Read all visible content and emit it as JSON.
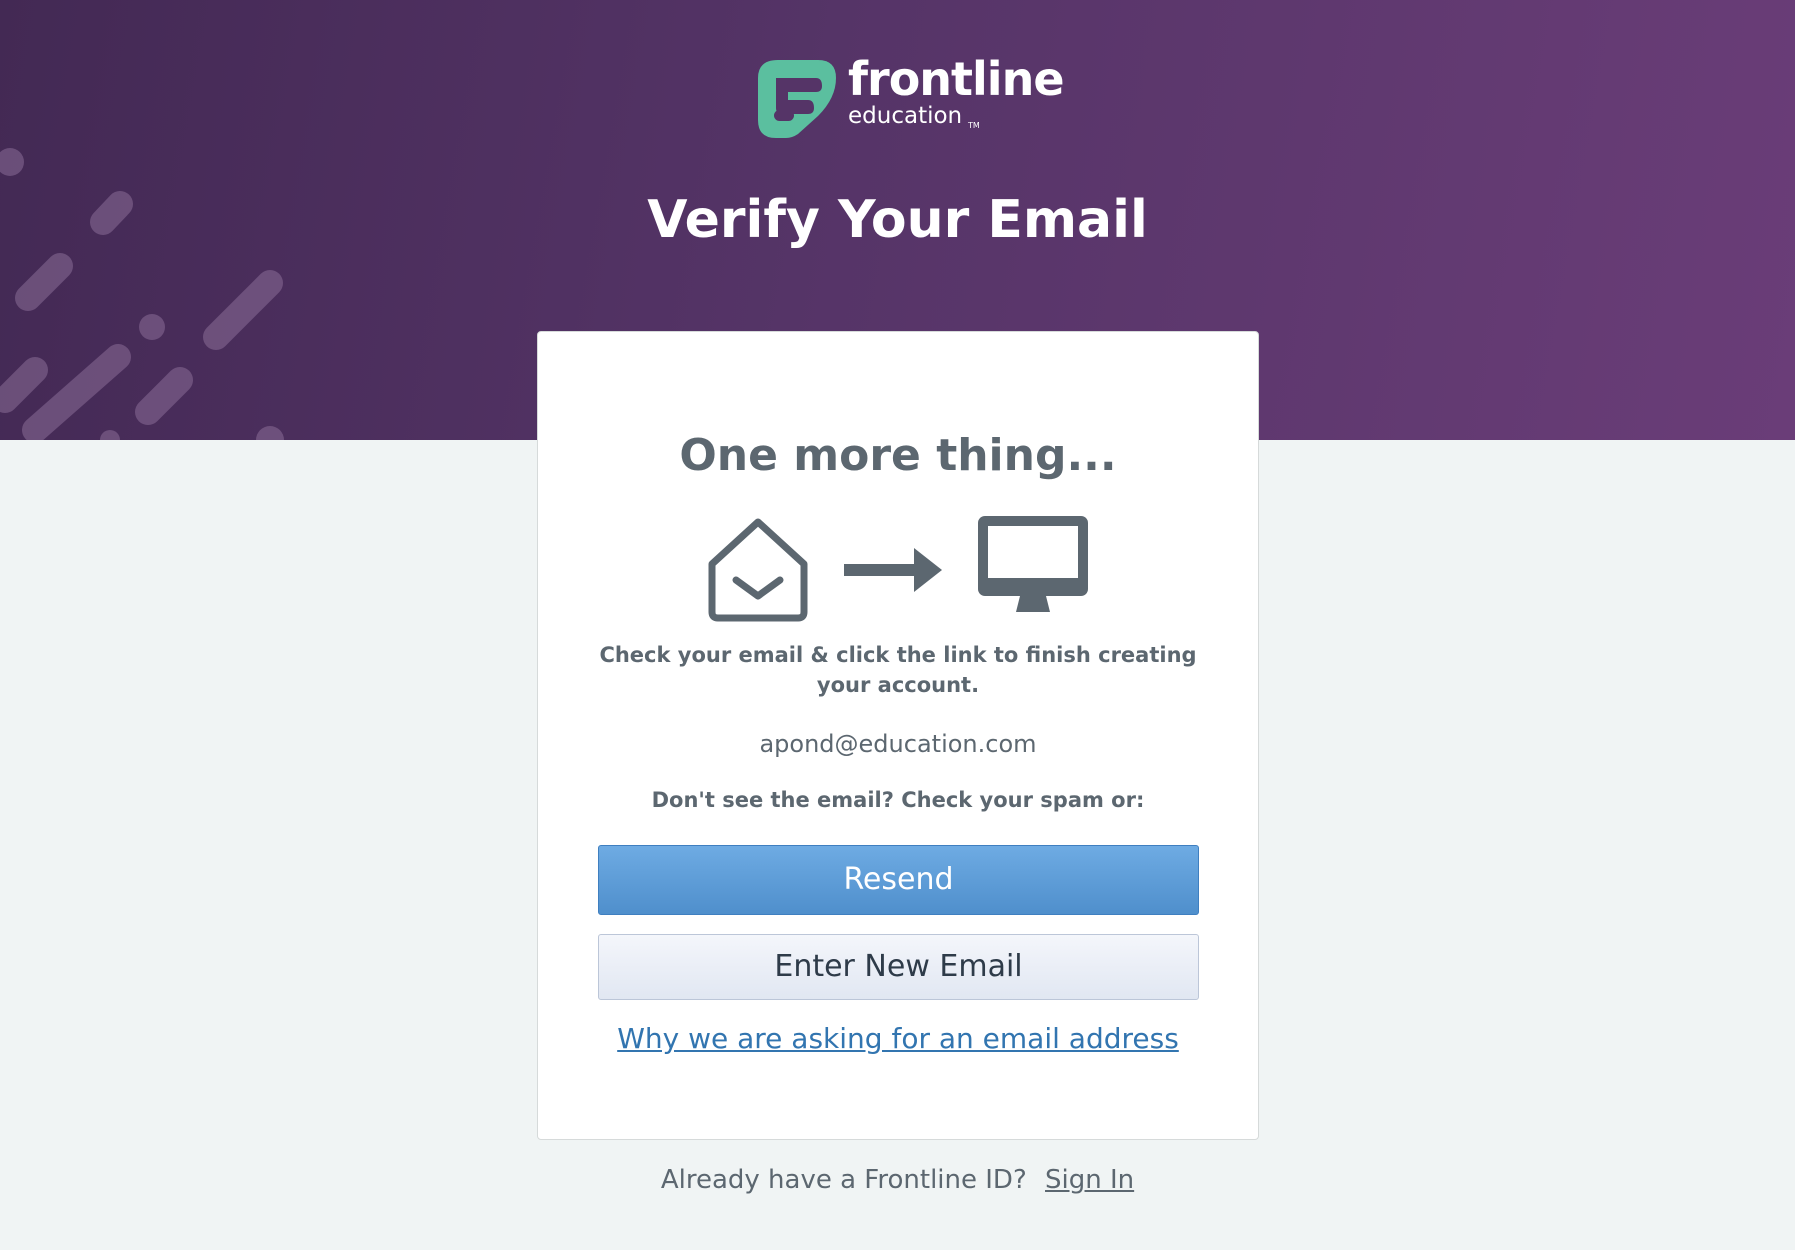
{
  "header": {
    "brand_name": "frontline",
    "brand_sub": "education",
    "brand_tm": "TM",
    "title": "Verify Your Email"
  },
  "card": {
    "heading": "One more thing...",
    "icons": [
      "open-envelope-icon",
      "arrow-right-icon",
      "desktop-monitor-icon"
    ],
    "instructions": "Check your email & click the link to finish creating your account.",
    "email": "apond@education.com",
    "spam_note": "Don't see the email? Check your spam or:",
    "resend_label": "Resend",
    "new_email_label": "Enter New Email",
    "why_link": "Why we are asking for an email address"
  },
  "footer": {
    "prompt": "Already have a Frontline ID?",
    "sign_in_label": "Sign In"
  },
  "colors": {
    "banner_start": "#432954",
    "banner_end": "#6a3d78",
    "logo_green": "#5bbf9f",
    "primary_button": "#5b9bd8",
    "link": "#3275b0",
    "text": "#5c6770",
    "page_background": "#f0f4f4"
  }
}
